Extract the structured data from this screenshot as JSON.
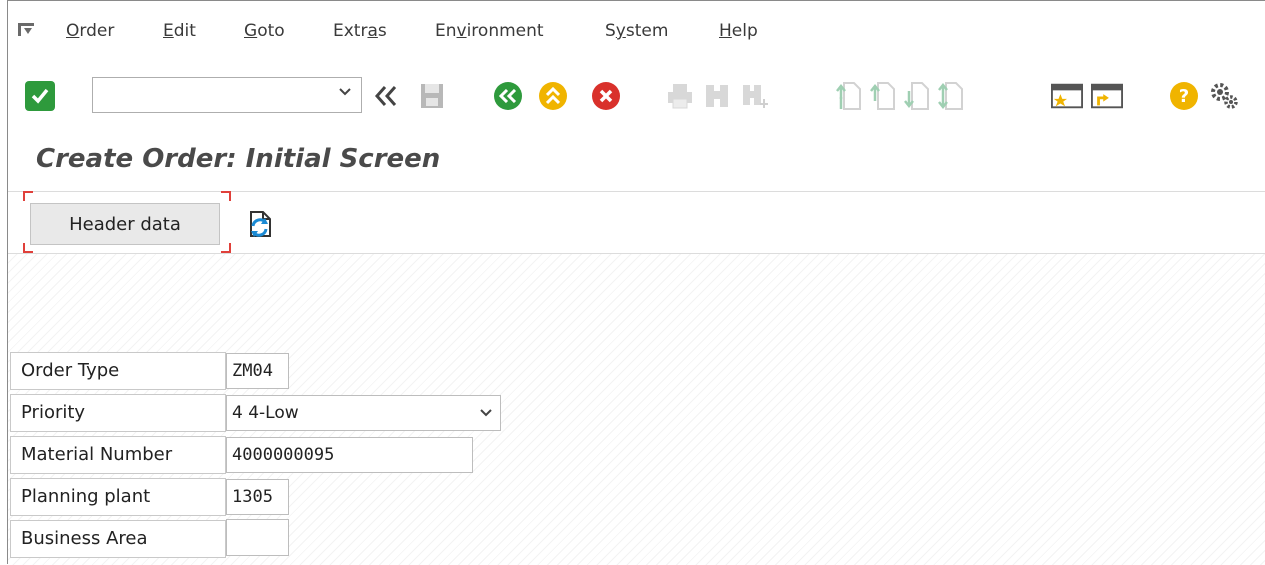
{
  "menu": {
    "items": [
      {
        "label": "Order"
      },
      {
        "label": "Edit"
      },
      {
        "label": "Goto"
      },
      {
        "label": "Extras"
      },
      {
        "label": "Environment"
      },
      {
        "label": "System"
      },
      {
        "label": "Help"
      }
    ]
  },
  "toolbar": {
    "command_field_value": "",
    "icons": [
      "enter-icon",
      "command-dropdown-icon",
      "back-arrows-icon",
      "save-icon",
      "back-icon",
      "exit-icon",
      "cancel-icon",
      "print-icon",
      "find-icon",
      "find-next-icon",
      "first-page-icon",
      "previous-page-icon",
      "next-page-icon",
      "last-page-icon",
      "create-session-icon",
      "shortcut-icon",
      "help-icon",
      "settings-gear-icon"
    ],
    "colors": {
      "enter": "#2e9a3c",
      "back": "#2e9a3c",
      "exit": "#f0b400",
      "cancel": "#d9312b",
      "help": "#f0b400",
      "disabled": "#9fcfb2"
    }
  },
  "page": {
    "title": "Create Order: Initial Screen"
  },
  "app_toolbar": {
    "header_data_label": "Header data"
  },
  "form": {
    "order_type": {
      "label": "Order Type",
      "value": "ZM04"
    },
    "priority": {
      "label": "Priority",
      "value": "4 4-Low"
    },
    "material_number": {
      "label": "Material Number",
      "value": "4000000095"
    },
    "planning_plant": {
      "label": "Planning plant",
      "value": "1305"
    },
    "business_area": {
      "label": "Business Area",
      "value": ""
    }
  }
}
